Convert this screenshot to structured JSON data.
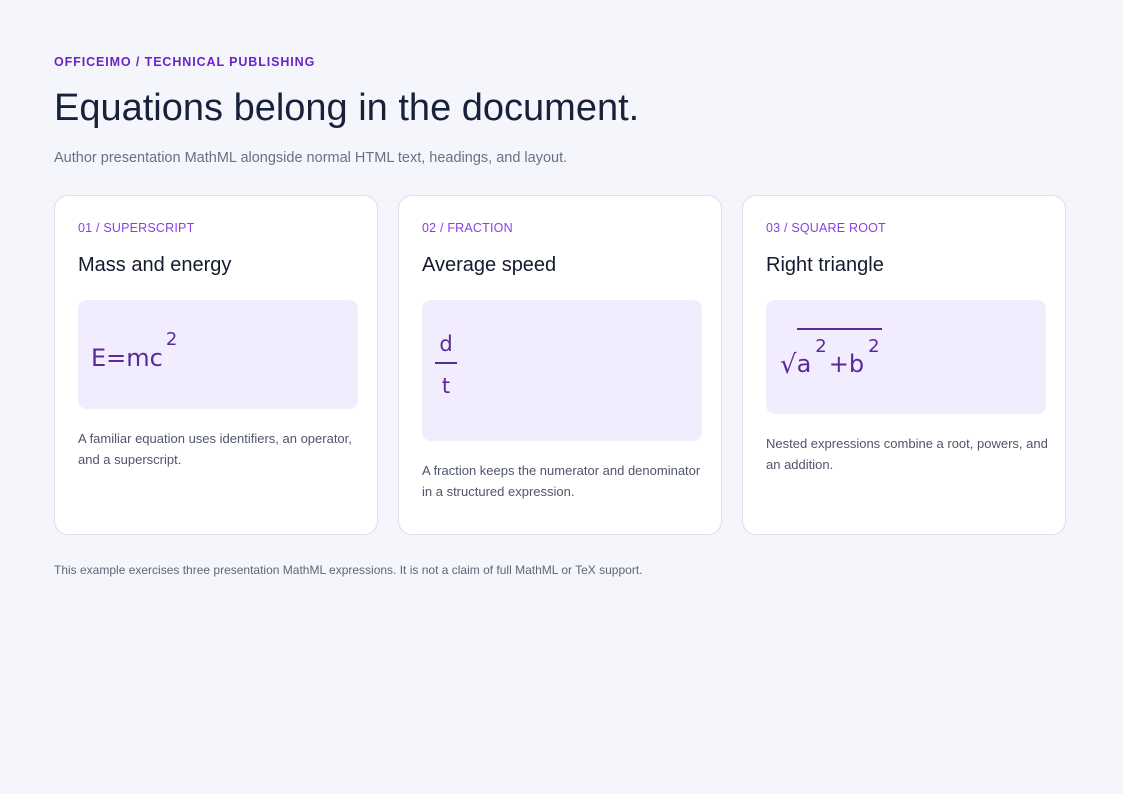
{
  "header": {
    "eyebrow": "OFFICEIMO / TECHNICAL PUBLISHING",
    "title": "Equations belong in the document.",
    "subtitle": "Author presentation MathML alongside normal HTML text, headings, and layout."
  },
  "cards": [
    {
      "label": "01 / SUPERSCRIPT",
      "title": "Mass and energy",
      "equation": {
        "base": "E=mc",
        "sup": "2"
      },
      "description": "A familiar equation uses identifiers, an operator, and a superscript."
    },
    {
      "label": "02 / FRACTION",
      "title": "Average speed",
      "equation": {
        "numerator": "d",
        "denominator": "t"
      },
      "description": "A fraction keeps the numerator and denominator in a structured expression."
    },
    {
      "label": "03 / SQUARE ROOT",
      "title": "Right triangle",
      "equation": {
        "radical": "√",
        "a": "a",
        "a_sup": "2",
        "plus": "+b",
        "b_sup": "2"
      },
      "description": "Nested expressions combine a root, powers, and an addition."
    }
  ],
  "footer": "This example exercises three presentation MathML expressions. It is not a claim of full MathML or TeX support.",
  "colors": {
    "accent": "#6a24c9",
    "math": "#5b2a98",
    "equation_background": "#f1ecfe",
    "page_background": "#f5f5fc"
  }
}
